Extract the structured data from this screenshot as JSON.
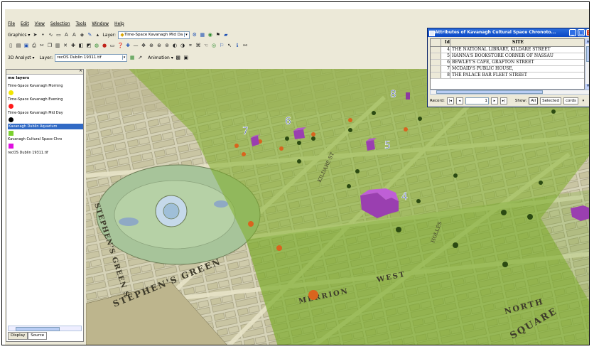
{
  "menu": [
    "File",
    "Edit",
    "View",
    "Selection",
    "Tools",
    "Window",
    "Help"
  ],
  "toolbar": {
    "graphics_label": "Graphics",
    "layer_label": "Layer:",
    "layer_value": "Time-Space Kavanagh Mid Da",
    "analyst_label": "3D Analyst",
    "analyst_layer_label": "Layer:",
    "analyst_layer_value": "recOS Dublin 19311.tif",
    "animation_label": "Animation"
  },
  "toc": {
    "title": "me layers",
    "layers": [
      {
        "name": "Time-Space Kavanagh Morning",
        "color": "#f2e600"
      },
      {
        "name": "Time-Space Kavanagh Evening",
        "color": "#ff1a1a"
      },
      {
        "name": "Time-Space Kavanagh Mid Day",
        "color": "#000000"
      },
      {
        "name": "Kavanagh Dublin Aquarium",
        "color": "#7cd12e"
      },
      {
        "name": "Kavanagh Cultural  Space Chro",
        "color": "#e010e0"
      },
      {
        "name": "recOS Dublin 19311.tif",
        "color": ""
      }
    ],
    "tabs": [
      "Display",
      "Source"
    ]
  },
  "attributes": {
    "title": "Attributes of Kavanagh Cultural  Space Chronoto...",
    "columns": [
      "Id",
      "SITE"
    ],
    "rows": [
      {
        "id": "4",
        "site": "THE NATIONAL LIBRARY, KILDARE STREET"
      },
      {
        "id": "5",
        "site": "HANNA'S BOOKSTORE CORNER OF NASSAU"
      },
      {
        "id": "6",
        "site": "BEWLEY'S CAFE, GRAFTON STREET"
      },
      {
        "id": "7",
        "site": "MCDAID'S PUBLIC HOUSE,"
      },
      {
        "id": "8",
        "site": "THE PALACE BAR FLEET STREET"
      }
    ],
    "record_label": "Record:",
    "record_value": "1",
    "show_label": "Show:",
    "all_label": "All",
    "selected_label": "Selected",
    "records_label": "cords"
  },
  "map": {
    "site_labels": [
      "8",
      "7",
      "6",
      "5",
      "4"
    ],
    "street_labels": [
      "STEPHEN'S GREEN",
      "STEPHEN'S GREEN S",
      "MERRION",
      "WEST",
      "NORTH",
      "SQUARE",
      "KILDARE ST",
      "HOLLES"
    ]
  },
  "colors": {
    "map_green": "#7fae2a",
    "site_magenta": "#a033b8",
    "label_blue": "#2f4a9c",
    "titlebar_blue": "#0a47c4"
  }
}
